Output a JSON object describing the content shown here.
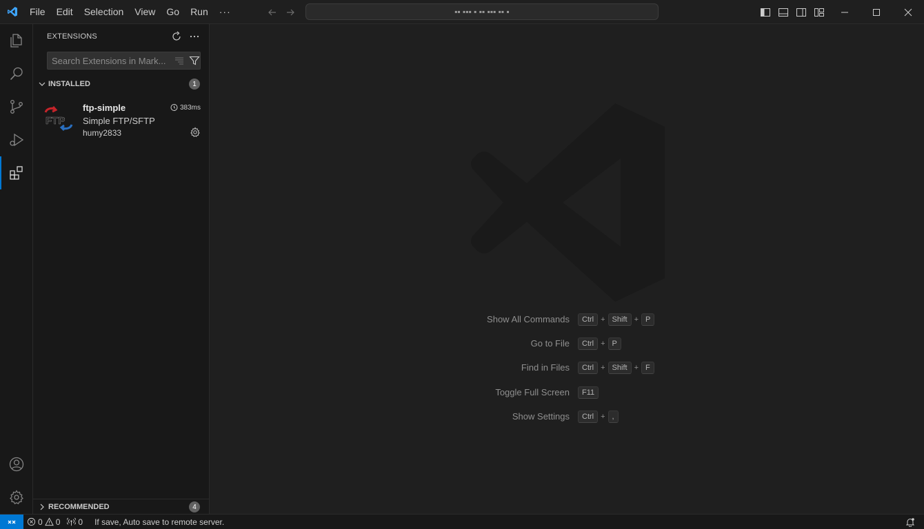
{
  "menu": [
    "File",
    "Edit",
    "Selection",
    "View",
    "Go",
    "Run"
  ],
  "menu_more": "···",
  "command_center": {
    "text": "▪▪ ▪▪▪ ▪ ▪▪ ▪▪▪ ▪▪ ▪"
  },
  "sidebar": {
    "title": "EXTENSIONS",
    "search_placeholder": "Search Extensions in Mark...",
    "installed": {
      "title": "INSTALLED",
      "count": "1",
      "extension": {
        "name": "ftp-simple",
        "description": "Simple FTP/SFTP",
        "publisher": "humy2833",
        "activation_time": "383ms",
        "logo_text": "FTP"
      }
    },
    "recommended": {
      "title": "RECOMMENDED",
      "count": "4"
    }
  },
  "shortcuts": [
    {
      "label": "Show All Commands",
      "keys": [
        "Ctrl",
        "Shift",
        "P"
      ]
    },
    {
      "label": "Go to File",
      "keys": [
        "Ctrl",
        "P"
      ]
    },
    {
      "label": "Find in Files",
      "keys": [
        "Ctrl",
        "Shift",
        "F"
      ]
    },
    {
      "label": "Toggle Full Screen",
      "keys": [
        "F11"
      ]
    },
    {
      "label": "Show Settings",
      "keys": [
        "Ctrl",
        ","
      ]
    }
  ],
  "statusbar": {
    "errors": "0",
    "warnings": "0",
    "ports": "0",
    "message": "If save, Auto save to remote server."
  },
  "colors": {
    "accent": "#0078d4",
    "background": "#1f1f1f",
    "sidebar": "#181818"
  }
}
